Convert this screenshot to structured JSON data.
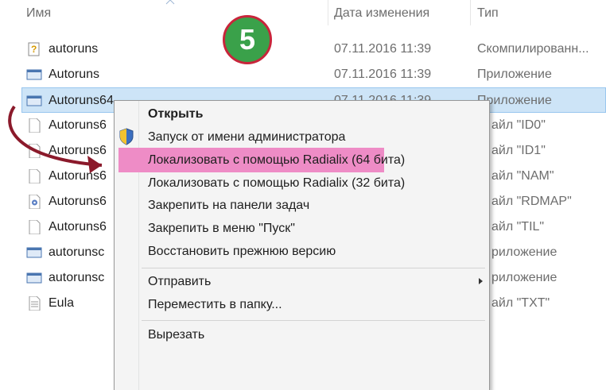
{
  "columns": {
    "name": "Имя",
    "date": "Дата изменения",
    "type": "Тип"
  },
  "step_badge": "5",
  "files": [
    {
      "name": "autoruns",
      "date": "07.11.2016 11:39",
      "type": "Скомпилированн...",
      "icon": "compiled-help-icon"
    },
    {
      "name": "Autoruns",
      "date": "07.11.2016 11:39",
      "type": "Приложение",
      "icon": "application-icon"
    },
    {
      "name": "Autoruns64",
      "date": "07.11.2016 11:39",
      "type": "Приложение",
      "icon": "application-icon",
      "selected": true
    },
    {
      "name": "Autoruns6",
      "type": "айл \"ID0\"",
      "icon": "generic-file-icon"
    },
    {
      "name": "Autoruns6",
      "type": "айл \"ID1\"",
      "icon": "generic-file-icon"
    },
    {
      "name": "Autoruns6",
      "type": "айл \"NAM\"",
      "icon": "generic-file-icon"
    },
    {
      "name": "Autoruns6",
      "type": "айл \"RDMAP\"",
      "icon": "gear-file-icon"
    },
    {
      "name": "Autoruns6",
      "type": "айл \"TIL\"",
      "icon": "generic-file-icon"
    },
    {
      "name": "autorunsc",
      "type": "риложение",
      "icon": "application-icon"
    },
    {
      "name": "autorunsc",
      "type": "риложение",
      "icon": "application-icon"
    },
    {
      "name": "Eula",
      "type": "айл \"TXT\"",
      "icon": "text-file-icon"
    }
  ],
  "context_menu": {
    "open": "Открыть",
    "run_as_admin": "Запуск от имени администратора",
    "localize_64": "Локализовать с помощью Radialix (64 бита)",
    "localize_32": "Локализовать с помощью Radialix (32 бита)",
    "pin_taskbar": "Закрепить на панели задач",
    "pin_start": "Закрепить в меню \"Пуск\"",
    "restore": "Восстановить прежнюю версию",
    "send_to": "Отправить",
    "move_to": "Переместить в папку...",
    "cut": "Вырезать"
  },
  "colors": {
    "highlight": "#ee8cc6",
    "selection": "#cde4f7",
    "badge_fill": "#3aa14a",
    "badge_ring": "#c8253b",
    "arrow": "#8b1a2b"
  }
}
